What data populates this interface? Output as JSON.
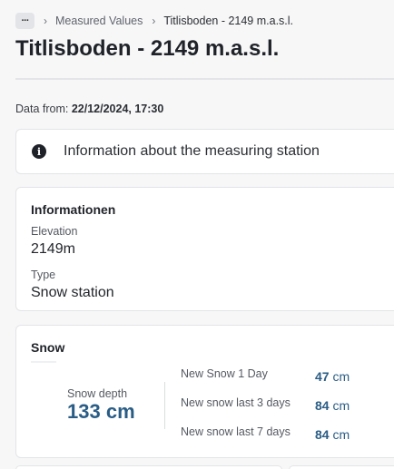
{
  "breadcrumb": {
    "more_label": "···",
    "items": [
      "Measured Values",
      "Titlisboden - 2149 m.a.s.l."
    ]
  },
  "page": {
    "title": "Titlisboden - 2149 m.a.s.l.",
    "data_from_label": "Data from:",
    "data_from_value": "22/12/2024, 17:30"
  },
  "info_card": {
    "icon": "info-circle-icon",
    "text": "Information about the measuring station"
  },
  "details": {
    "heading": "Informationen",
    "fields": [
      {
        "label": "Elevation",
        "value": "2149m"
      },
      {
        "label": "Type",
        "value": "Snow station"
      }
    ]
  },
  "snow": {
    "heading": "Snow",
    "depth_label": "Snow depth",
    "depth_value": "133",
    "depth_unit": "cm",
    "stats": [
      {
        "label": "New Snow 1 Day",
        "value": "47",
        "unit": "cm"
      },
      {
        "label": "New snow last 3 days",
        "value": "84",
        "unit": "cm"
      },
      {
        "label": "New snow last 7 days",
        "value": "84",
        "unit": "cm"
      }
    ]
  },
  "colors": {
    "accent": "#2a5d86",
    "background": "#f7f7f8",
    "card": "#ffffff"
  }
}
